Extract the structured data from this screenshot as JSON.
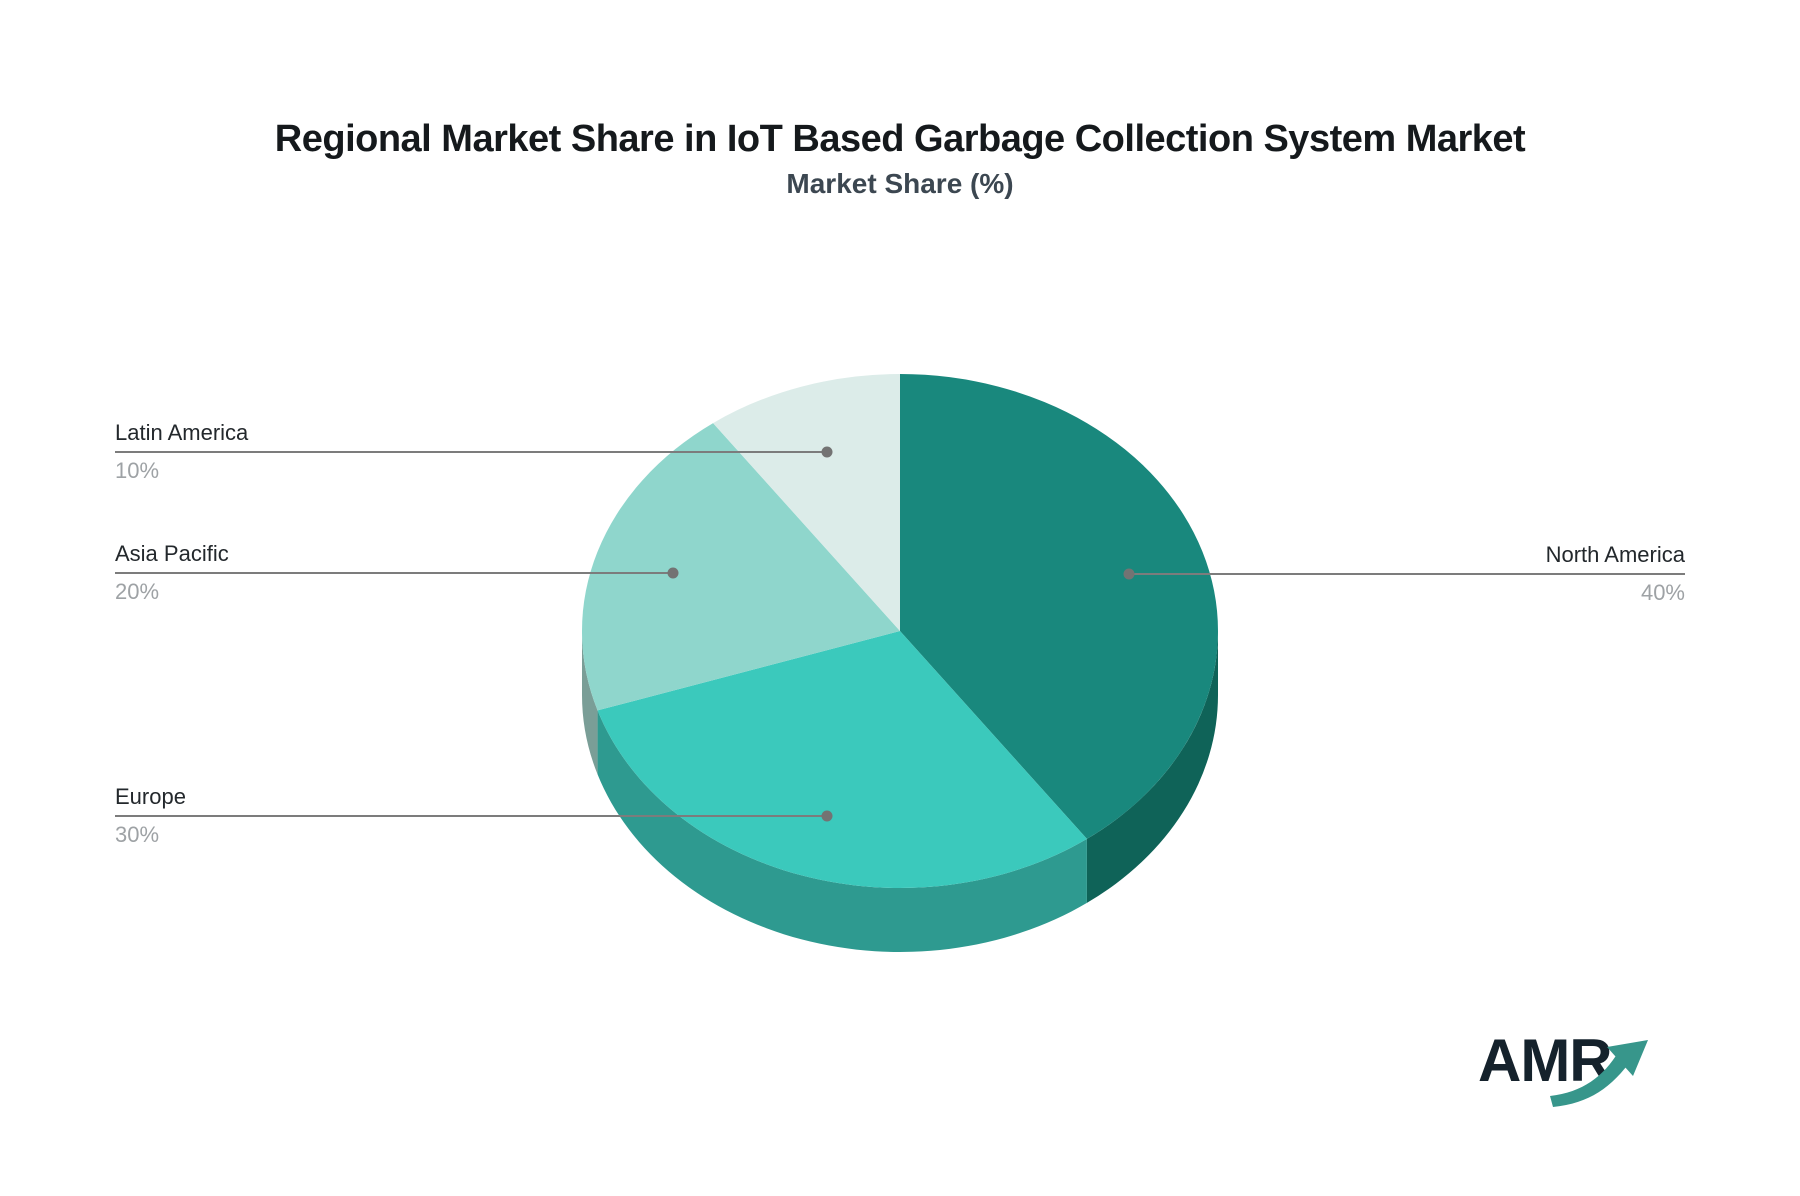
{
  "header": {
    "title": "Regional Market Share in IoT Based Garbage Collection System Market",
    "subtitle": "Market Share (%)"
  },
  "chart_data": {
    "type": "pie",
    "effect": "3d",
    "title": "Regional Market Share in IoT Based Garbage Collection System Market",
    "subtitle": "Market Share (%)",
    "unit": "%",
    "start_angle_deg": 0,
    "direction": "clockwise",
    "legend_position": "callout-labels",
    "categories": [
      "North America",
      "Europe",
      "Asia Pacific",
      "Latin America"
    ],
    "values": [
      40,
      30,
      20,
      10
    ],
    "slice_colors": [
      "#19887D",
      "#3BC9BC",
      "#8FD6CC",
      "#DCECE9"
    ],
    "slice_side_colors": [
      "#0F6358",
      "#2E9A90",
      "#7A9E97",
      "#C9E0DC"
    ],
    "callouts": [
      {
        "label": "Latin America",
        "value": "10%"
      },
      {
        "label": "Asia Pacific",
        "value": "20%"
      },
      {
        "label": "Europe",
        "value": "30%"
      },
      {
        "label": "North America",
        "value": "40%"
      }
    ]
  },
  "colors": {
    "title": "#15191C",
    "subtitle": "#3C4751",
    "label": "#23282C",
    "value": "#9EA2A5",
    "leader_line": "#7C7C7C",
    "leader_dot": "#737373"
  },
  "logo": {
    "text": "AMR",
    "text_color": "#15222C",
    "arrow_color": "#37968B"
  }
}
